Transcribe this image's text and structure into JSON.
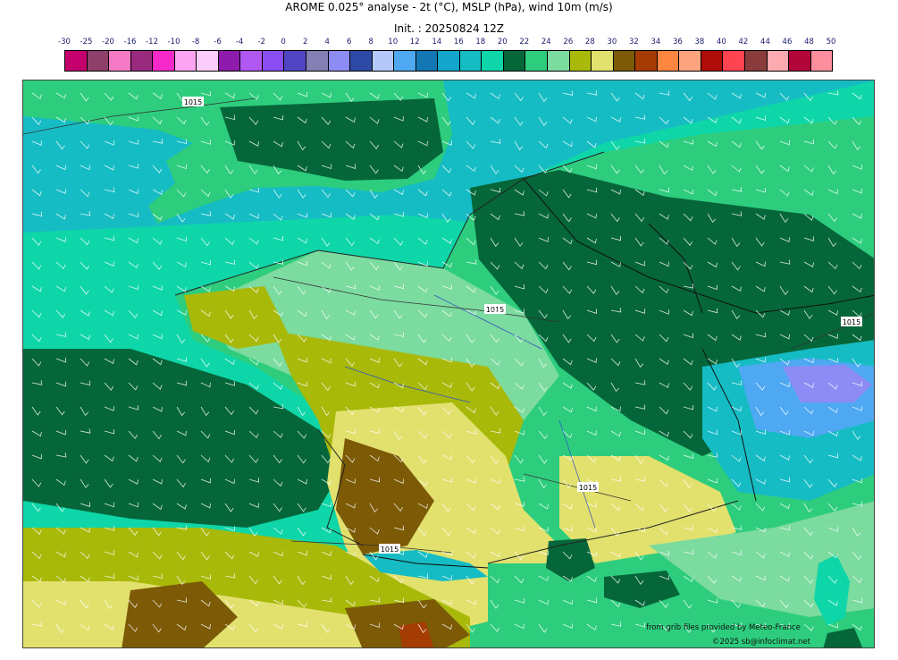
{
  "header": {
    "title": "AROME 0.025° analyse - 2t (°C), MSLP (hPa), wind 10m (m/s)",
    "init": "Init. : 20250824 12Z"
  },
  "colorscale": {
    "labels": [
      "-30",
      "-25",
      "-20",
      "-16",
      "-12",
      "-10",
      "-8",
      "-6",
      "-4",
      "-2",
      "0",
      "2",
      "4",
      "6",
      "8",
      "10",
      "12",
      "14",
      "16",
      "18",
      "20",
      "22",
      "24",
      "26",
      "28",
      "30",
      "32",
      "34",
      "36",
      "38",
      "40",
      "42",
      "44",
      "46",
      "48",
      "50"
    ],
    "colors": [
      "#c4006d",
      "#8e3f6a",
      "#f57ac6",
      "#9a2a7e",
      "#f429c7",
      "#fba4f1",
      "#fbcdfb",
      "#8e1bac",
      "#b058f1",
      "#8a4ef0",
      "#5245c3",
      "#8580b3",
      "#8d8cf5",
      "#2f4aa6",
      "#b4c9f9",
      "#4ea8f2",
      "#1477b4",
      "#14a6ca",
      "#16bcc4",
      "#0ed6a8",
      "#05663a",
      "#2dcd7d",
      "#7cdb9f",
      "#a8b90a",
      "#e2e16e",
      "#7c5a06",
      "#a43c04",
      "#fe8640",
      "#fea47e",
      "#ae0d08",
      "#fe4351",
      "#8a3b3b",
      "#fdaab0",
      "#b2063a",
      "#fd8e9e"
    ]
  },
  "map": {
    "isobar_labels": [
      "1015",
      "1015",
      "1015",
      "1015",
      "1015"
    ]
  },
  "footer": {
    "source": "from grib files provided by Meteo-France",
    "copyright": "©2025 sb@infoclimat.net"
  }
}
